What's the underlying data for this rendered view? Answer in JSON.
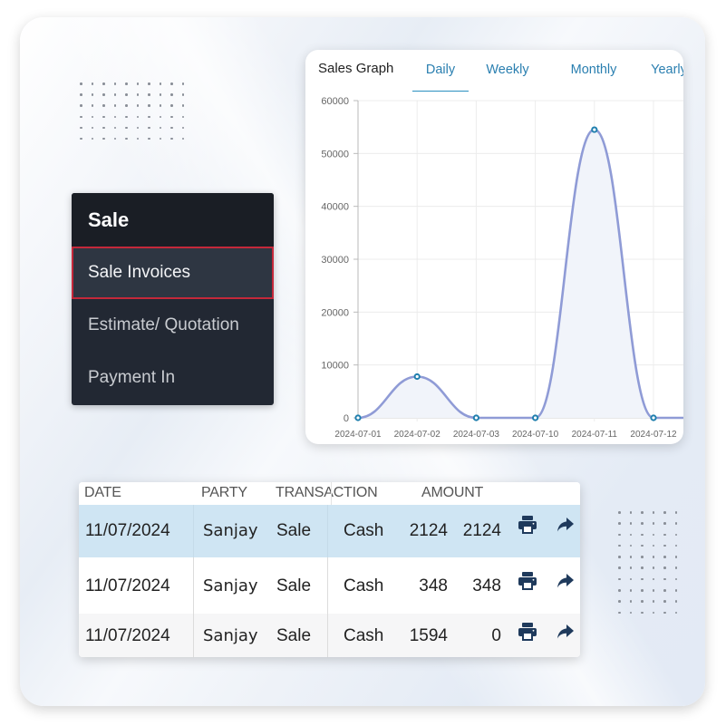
{
  "menu": {
    "title": "Sale",
    "items": [
      {
        "label": "Sale Invoices",
        "active": true
      },
      {
        "label": "Estimate/ Quotation",
        "active": false
      },
      {
        "label": "Payment In",
        "active": false
      }
    ],
    "colors": {
      "header": "#1a1e25",
      "body": "#222833",
      "active_bg": "#2e3642",
      "active_border": "#c4283a"
    }
  },
  "chart_card": {
    "title": "Sales Graph",
    "tabs": [
      {
        "label": "Daily",
        "active": true
      },
      {
        "label": "Weekly",
        "active": false
      },
      {
        "label": "Monthly",
        "active": false
      },
      {
        "label": "Yearly",
        "active": false
      }
    ],
    "accent": "#2a7fb0"
  },
  "chart_data": {
    "type": "area",
    "title": "Sales Graph",
    "xlabel": "",
    "ylabel": "",
    "categories": [
      "2024-07-01",
      "2024-07-02",
      "2024-07-03",
      "2024-07-10",
      "2024-07-11",
      "2024-07-12"
    ],
    "series": [
      {
        "name": "Sales",
        "values": [
          0,
          7800,
          0,
          0,
          54500,
          0
        ],
        "color": "#8f9bd6",
        "fill": "#f1f4fa",
        "point_color": "#1f7fae"
      }
    ],
    "trailing_value": 0,
    "yticks": [
      0,
      10000,
      20000,
      30000,
      40000,
      50000,
      60000
    ],
    "ylim": [
      0,
      60000
    ],
    "grid": true,
    "legend": "none",
    "curve": "smooth"
  },
  "table": {
    "headers": [
      "DATE",
      "PARTY",
      "TRANSACTION",
      "AMOUNT"
    ],
    "rows": [
      {
        "date": "11/07/2024",
        "party": "Sanjay",
        "transaction": "Sale",
        "mode": "Cash",
        "total": "2124",
        "balance": "2124",
        "selected": true
      },
      {
        "date": "11/07/2024",
        "party": "Sanjay",
        "transaction": "Sale",
        "mode": "Cash",
        "total": "348",
        "balance": "348",
        "selected": false
      },
      {
        "date": "11/07/2024",
        "party": "Sanjay",
        "transaction": "Sale",
        "mode": "Cash",
        "total": "1594",
        "balance": "0",
        "selected": false
      }
    ],
    "row_actions": [
      "print-icon",
      "share-icon"
    ],
    "icon_color": "#1f3a5c",
    "selected_row_bg": "#cfe5f3"
  }
}
